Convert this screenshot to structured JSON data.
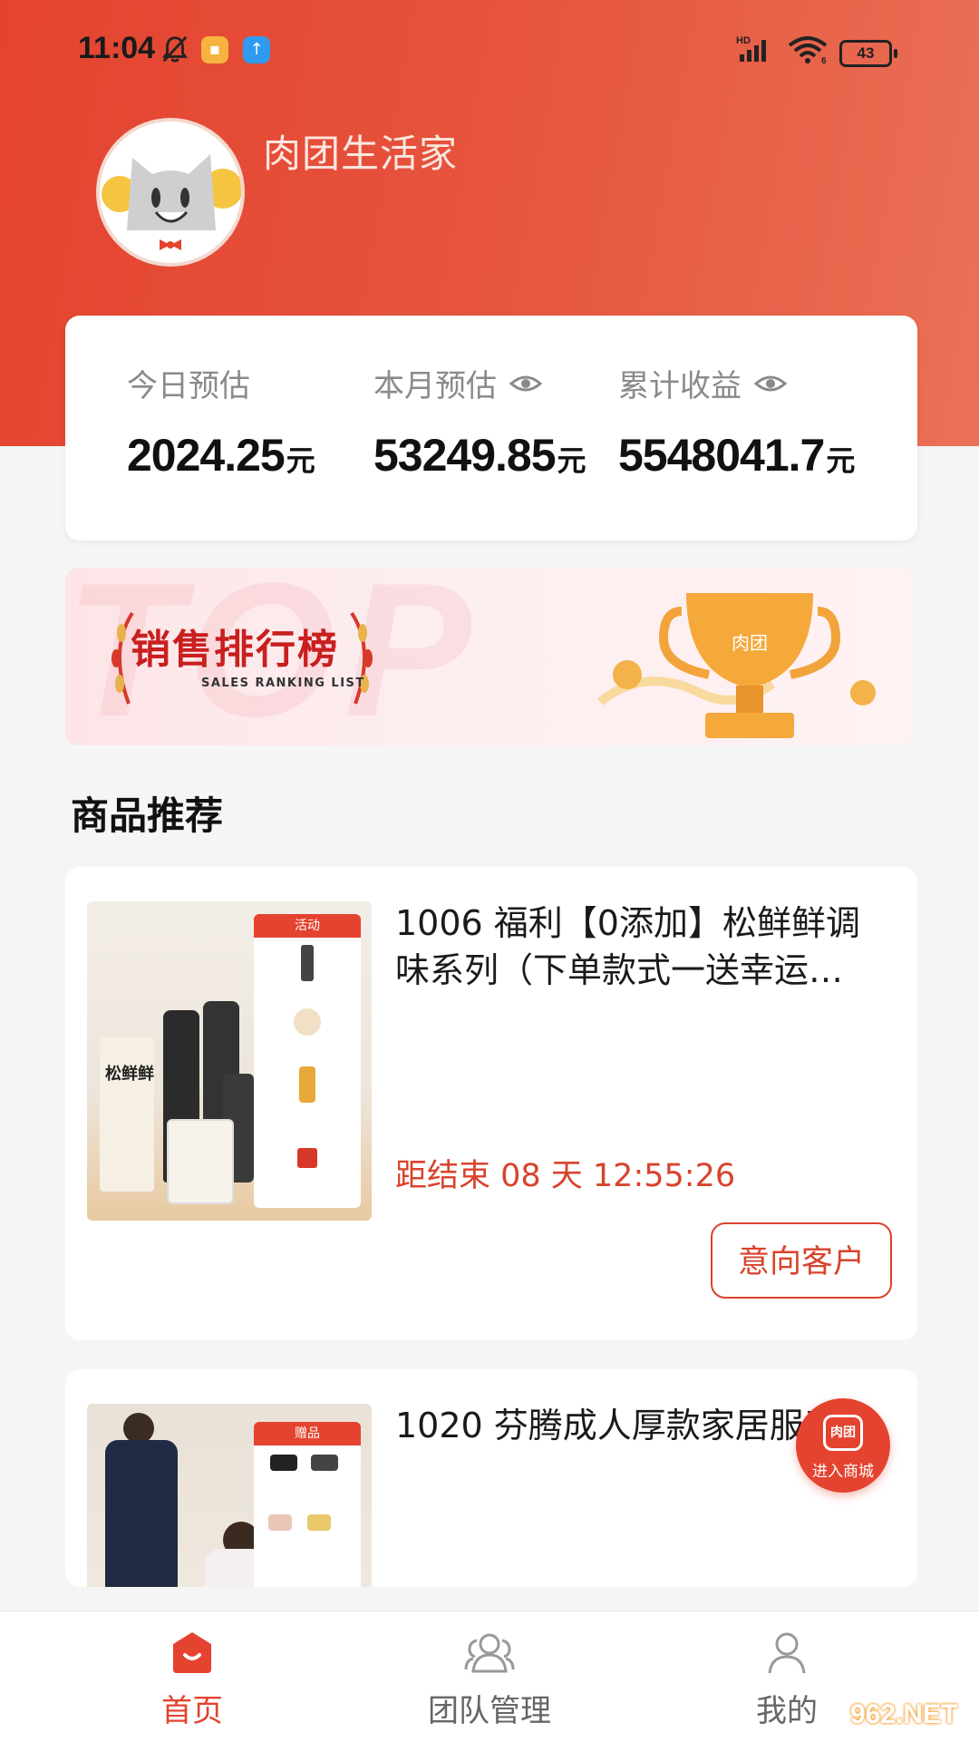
{
  "status_bar": {
    "time": "11:04",
    "battery": "43",
    "icons": [
      "bell-mute-icon",
      "message-app-icon",
      "upload-app-icon",
      "hd-signal-icon",
      "wifi-icon",
      "battery-icon"
    ]
  },
  "profile": {
    "brand_name": "肉团生活家",
    "avatar": "mascot-avatar"
  },
  "earnings": {
    "items": [
      {
        "label": "今日预估",
        "value": "2024.25",
        "unit": "元",
        "has_eye_icon": false
      },
      {
        "label": "本月预估",
        "value": "53249.85",
        "unit": "元",
        "has_eye_icon": true
      },
      {
        "label": "累计收益",
        "value": "5548041.7",
        "unit": "元",
        "has_eye_icon": true
      }
    ]
  },
  "banner": {
    "title": "销售排行榜",
    "subtitle": "SALES RANKING LIST",
    "background_text": "TOP",
    "trophy_label": "肉团"
  },
  "section": {
    "title": "商品推荐"
  },
  "products": [
    {
      "title": "1006 福利【0添加】松鲜鲜调味系列（下单款式一送幸运…",
      "countdown": "距结束 08 天 12:55:26",
      "button": "意向客户",
      "thumb_tag": "活动",
      "thumb_brand": "松鲜鲜"
    },
    {
      "title": "1020 芬腾成人厚款家居服系列",
      "thumb_tag": "赠品"
    }
  ],
  "fab": {
    "icon_text": "肉团",
    "label": "进入商城"
  },
  "tabbar": {
    "items": [
      {
        "label": "首页",
        "active": true
      },
      {
        "label": "团队管理",
        "active": false
      },
      {
        "label": "我的",
        "active": false
      }
    ]
  },
  "watermark": "962.NET",
  "colors": {
    "primary": "#e4432f",
    "accent_text": "#d8432c",
    "banner_red": "#c91f1f"
  }
}
